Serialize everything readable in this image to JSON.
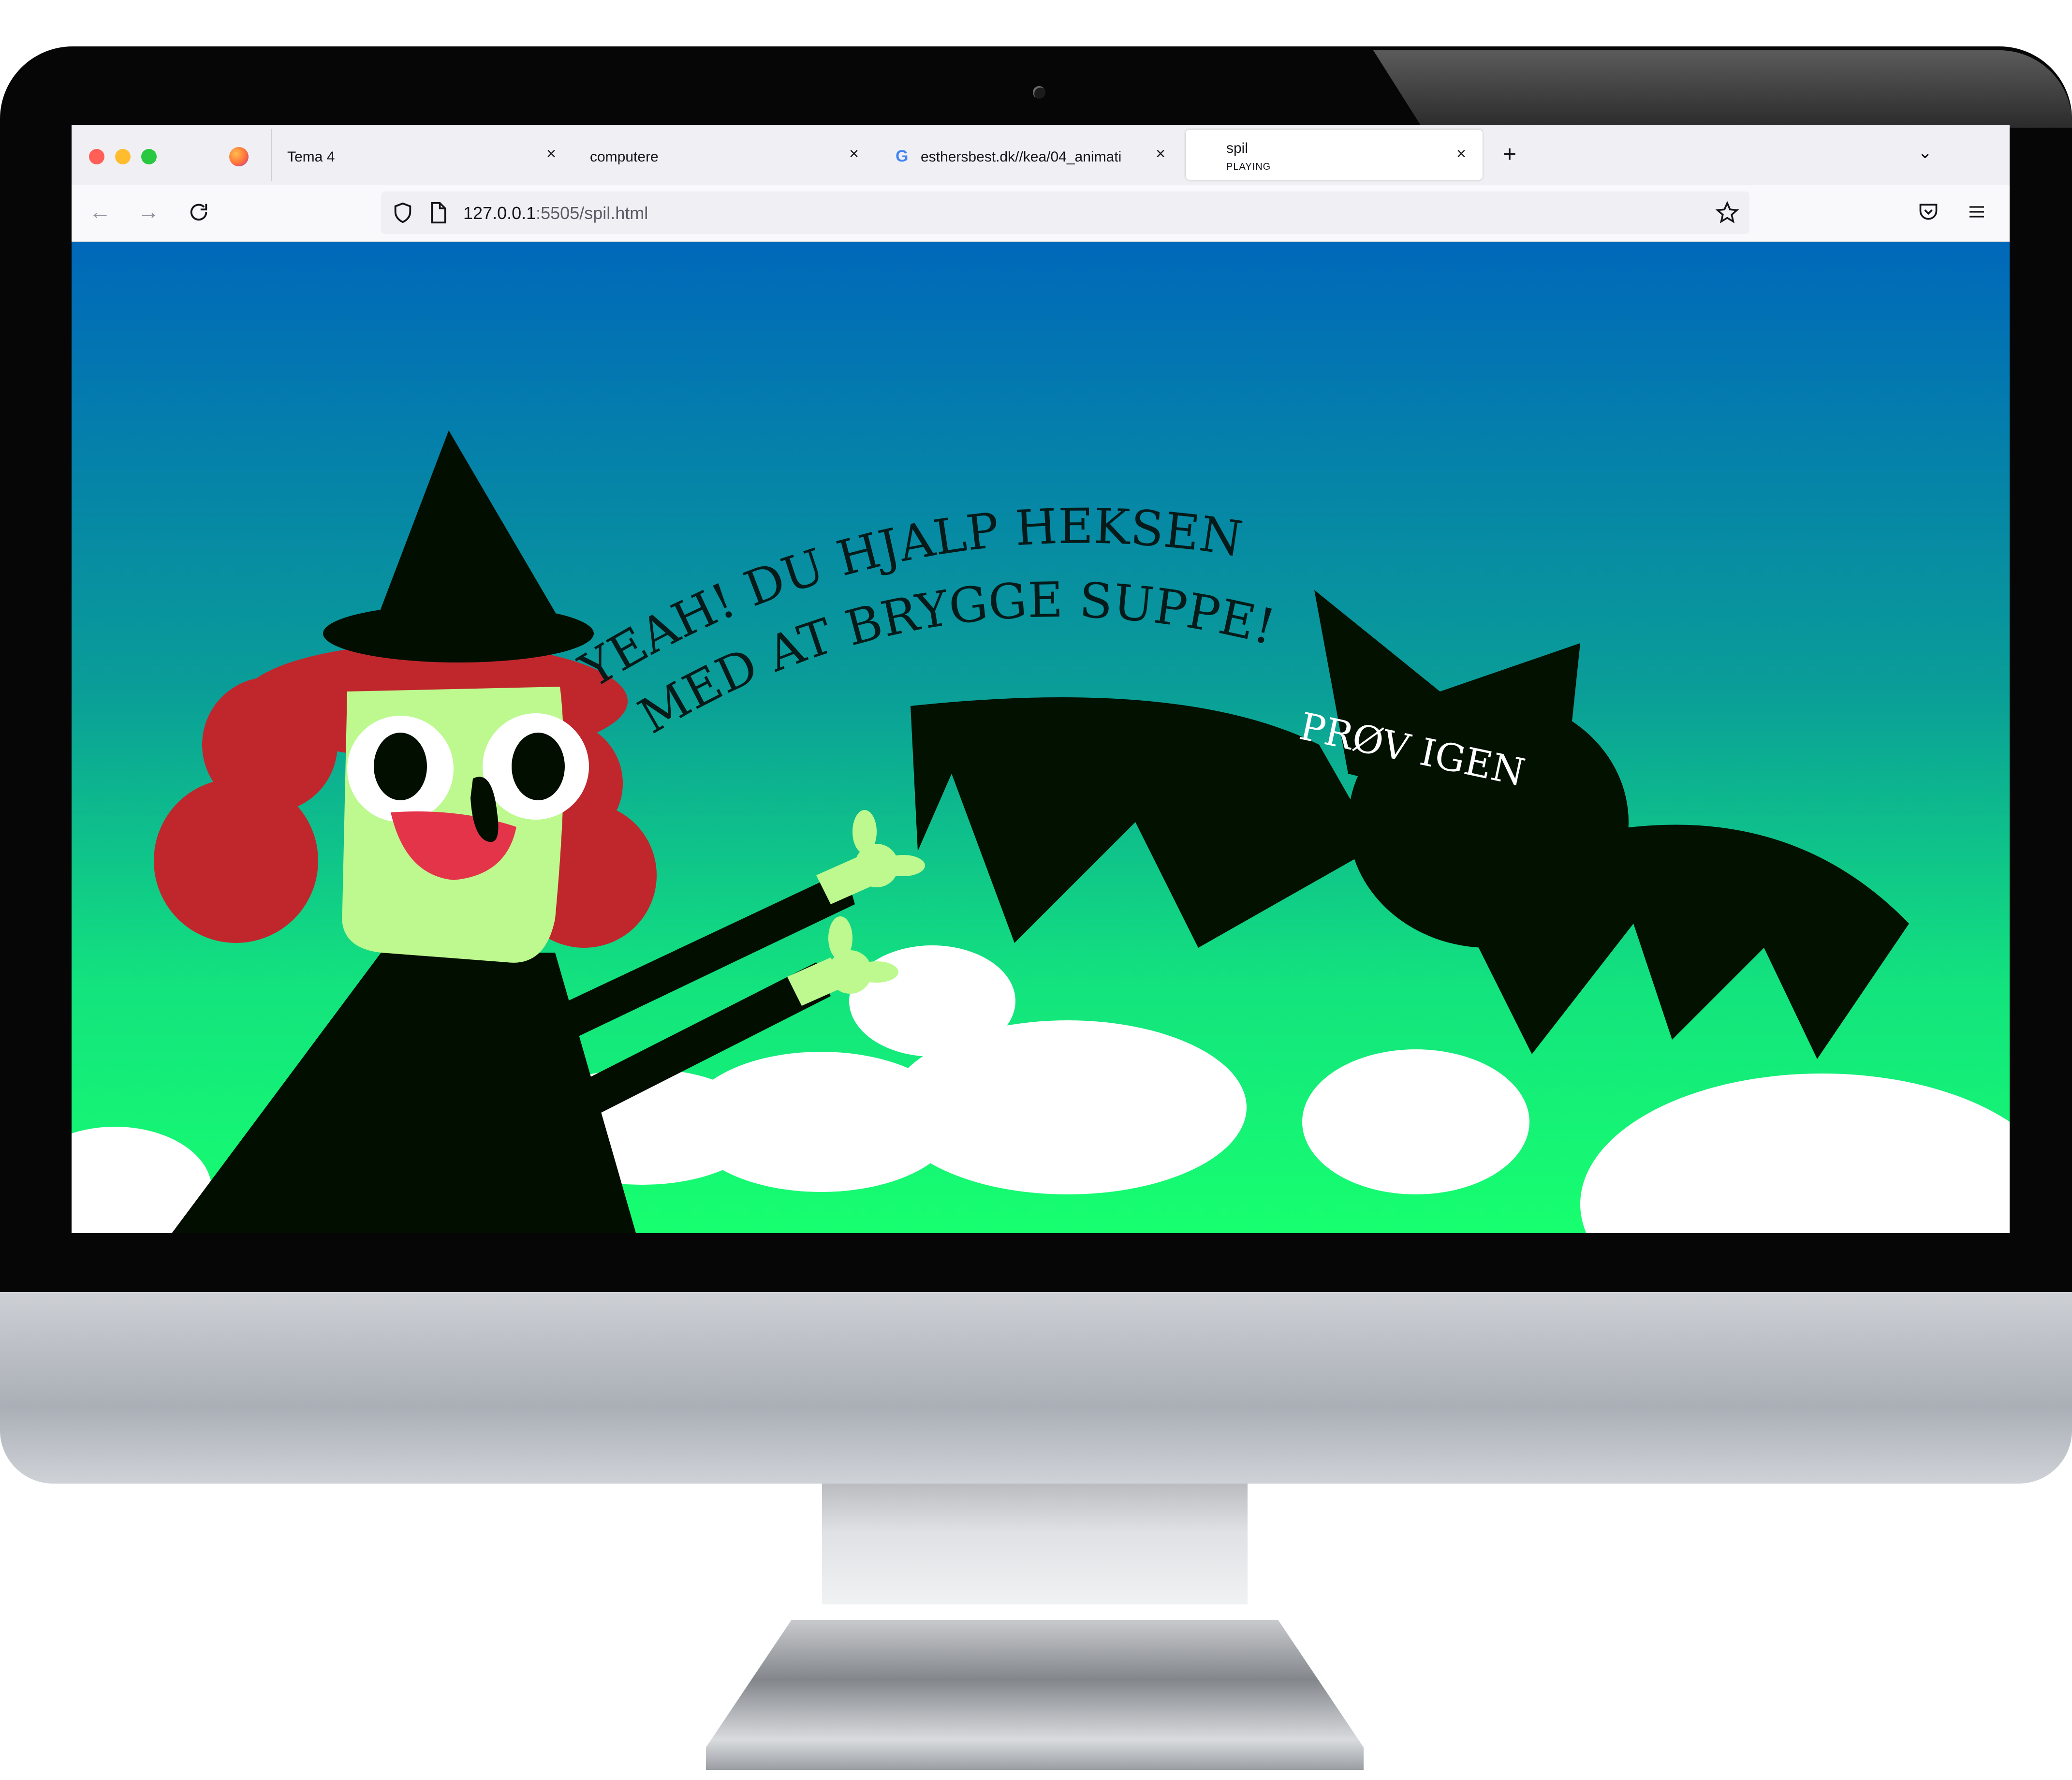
{
  "browser": {
    "tabs": [
      {
        "label": "Tema 4",
        "icon": "firefox-icon"
      },
      {
        "label": "computere"
      },
      {
        "label": "esthersbest.dk//kea/04_animati",
        "icon": "google-icon"
      },
      {
        "label": "spil",
        "status": "PLAYING",
        "active": true
      }
    ],
    "close_glyph": "×",
    "new_tab": "+",
    "tab_list": "⌄",
    "address": {
      "host": "127.0.0.1",
      "path": ":5505/spil.html"
    }
  },
  "game": {
    "message_line1": "YEAH! DU HJALP HEKSEN",
    "message_line2": "MED AT BRYGGE SUPPE!",
    "retry_label": "PRØV IGEN"
  },
  "colors": {
    "sky_top": "#0068ba",
    "sky_bottom": "#17ff6f",
    "witch_dress": "#020f00",
    "witch_hair": "#c0272d",
    "witch_skin": "#bdf98f",
    "bat": "#021100"
  }
}
